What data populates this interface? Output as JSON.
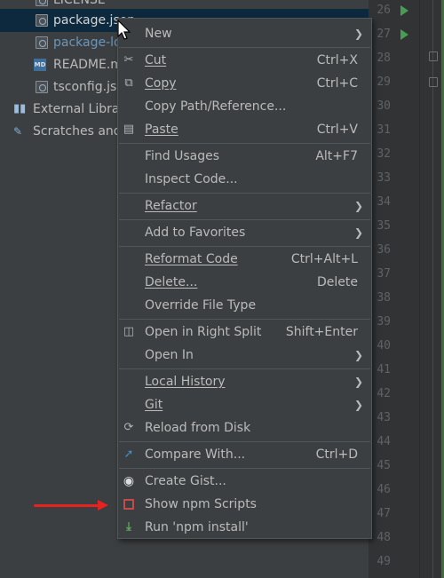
{
  "project_tree": {
    "items": [
      {
        "label": "LICENSE",
        "icon": "file-icon"
      },
      {
        "label": "package.json",
        "icon": "json-file-icon"
      },
      {
        "label": "package-lo",
        "icon": "json-file-icon"
      },
      {
        "label": "README.m",
        "icon": "markdown-file-icon"
      },
      {
        "label": "tsconfig.jso",
        "icon": "json-file-icon"
      },
      {
        "label": "External Librar",
        "icon": "libraries-icon"
      },
      {
        "label": "Scratches and",
        "icon": "scratches-icon"
      }
    ]
  },
  "gutter": {
    "line_numbers": [
      "26",
      "27",
      "28",
      "29",
      "30",
      "31",
      "32",
      "33",
      "34",
      "35",
      "36",
      "37",
      "38",
      "39",
      "40",
      "41",
      "42",
      "43",
      "44",
      "45",
      "46",
      "47",
      "48",
      "49"
    ]
  },
  "context_menu": {
    "items": {
      "new": {
        "label": "New"
      },
      "cut": {
        "label": "Cut",
        "shortcut": "Ctrl+X",
        "icon": "scissors-icon"
      },
      "copy": {
        "label": "Copy",
        "shortcut": "Ctrl+C",
        "icon": "copy-icon"
      },
      "copy_path": {
        "label": "Copy Path/Reference..."
      },
      "paste": {
        "label": "Paste",
        "shortcut": "Ctrl+V",
        "icon": "clipboard-icon"
      },
      "find_usages": {
        "label": "Find Usages",
        "shortcut": "Alt+F7"
      },
      "inspect_code": {
        "label": "Inspect Code..."
      },
      "refactor": {
        "label": "Refactor"
      },
      "add_favorites": {
        "label": "Add to Favorites"
      },
      "reformat_code": {
        "label": "Reformat Code",
        "shortcut": "Ctrl+Alt+L"
      },
      "delete": {
        "label": "Delete...",
        "shortcut": "Delete"
      },
      "override_file_type": {
        "label": "Override File Type"
      },
      "open_right_split": {
        "label": "Open in Right Split",
        "shortcut": "Shift+Enter",
        "icon": "split-icon"
      },
      "open_in": {
        "label": "Open In"
      },
      "local_history": {
        "label": "Local History"
      },
      "git": {
        "label": "Git"
      },
      "reload_disk": {
        "label": "Reload from Disk",
        "icon": "reload-icon"
      },
      "compare_with": {
        "label": "Compare With...",
        "shortcut": "Ctrl+D",
        "icon": "compare-icon"
      },
      "create_gist": {
        "label": "Create Gist...",
        "icon": "github-icon"
      },
      "show_npm": {
        "label": "Show npm Scripts",
        "icon": "npm-icon"
      },
      "run_npm_install": {
        "label": "Run 'npm install'",
        "icon": "download-icon"
      }
    }
  },
  "colors": {
    "background": "#3c3f41",
    "selection": "#0d293e",
    "annotation_arrow": "#e8221f",
    "run_marker": "#499c54"
  }
}
